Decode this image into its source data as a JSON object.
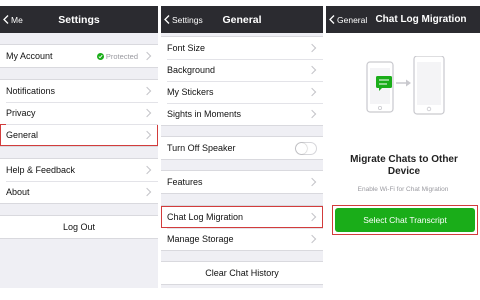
{
  "screen1": {
    "back": "Me",
    "title": "Settings",
    "account": {
      "label": "My Account",
      "status": "Protected"
    },
    "items": [
      "Notifications",
      "Privacy",
      "General"
    ],
    "help": "Help & Feedback",
    "about": "About",
    "logout": "Log Out"
  },
  "screen2": {
    "back": "Settings",
    "title": "General",
    "group1": [
      "Font Size",
      "Background",
      "My Stickers",
      "Sights in Moments"
    ],
    "speaker": "Turn Off Speaker",
    "speaker_on": false,
    "features": "Features",
    "group3": [
      "Chat Log Migration",
      "Manage Storage"
    ],
    "clear": "Clear Chat History"
  },
  "screen3": {
    "back": "General",
    "title": "Chat Log Migration",
    "heading": "Migrate Chats to Other Device",
    "subtitle": "Enable Wi-Fi for Chat Migration",
    "button": "Select Chat Transcript"
  },
  "colors": {
    "navbar": "#2b2b30",
    "accent_green": "#1aad19",
    "highlight_red": "#d23c3c",
    "background": "#efeff4"
  }
}
